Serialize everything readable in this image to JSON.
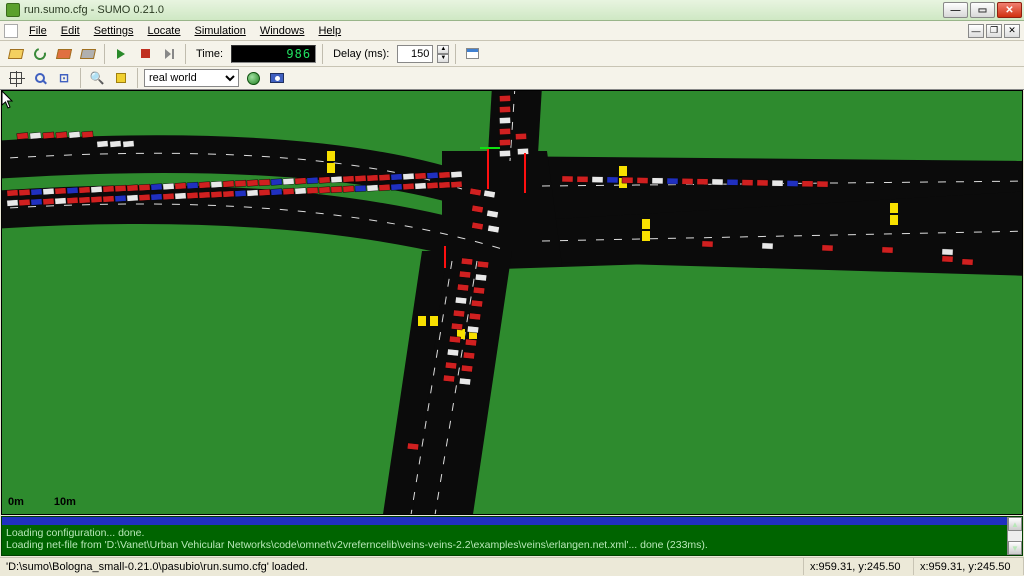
{
  "window": {
    "title": "run.sumo.cfg - SUMO 0.21.0",
    "min_tip": "Minimize",
    "max_tip": "Maximize",
    "close_tip": "Close"
  },
  "menu": {
    "file": "File",
    "edit": "Edit",
    "settings": "Settings",
    "locate": "Locate",
    "simulation": "Simulation",
    "windows": "Windows",
    "help": "Help"
  },
  "toolbar": {
    "time_label": "Time:",
    "time_value": "986",
    "delay_label": "Delay (ms):",
    "delay_value": "150",
    "view_mode": "real world"
  },
  "scale": {
    "zero": "0m",
    "ten": "10m"
  },
  "log": {
    "line1": "Loading configuration... done.",
    "line2": "Loading net-file from 'D:\\Vanet\\Urban Vehicular Networks\\code\\omnet\\v2vreferncelib\\veins-veins-2.2\\examples\\veins\\erlangen.net.xml'...  done (233ms)."
  },
  "status": {
    "path": "'D:\\sumo\\Bologna_small-0.21.0\\pasubio\\run.sumo.cfg' loaded.",
    "coord1": "x:959.31, y:245.50",
    "coord2": "x:959.31, y:245.50"
  },
  "icons": {
    "open": "open-folder",
    "reload": "reload",
    "save": "save",
    "print": "print",
    "play": "play",
    "stop": "stop",
    "step": "step",
    "app": "app-window",
    "target": "pan-crosshair",
    "zoom": "zoom",
    "zoomin": "zoom-in",
    "hand": "grab",
    "flag": "highlight",
    "globe": "color-scheme",
    "camera": "screenshot"
  },
  "vehicles": {
    "colors": {
      "car": "#d02020",
      "car2": "#2030c0",
      "car3": "#e8e8e8",
      "car4": "#e8c820",
      "bus": "#f0d000"
    }
  }
}
